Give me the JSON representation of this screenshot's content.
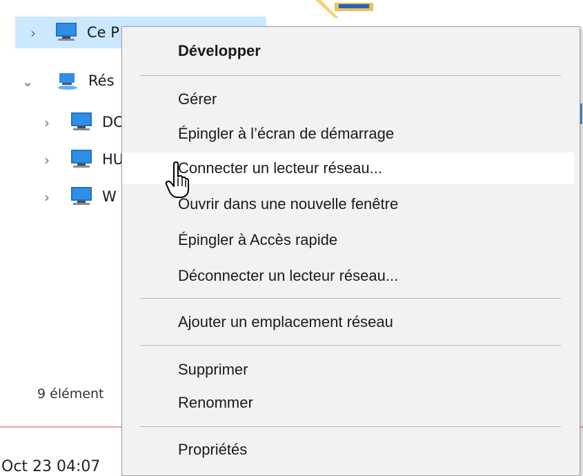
{
  "nav": {
    "items": [
      {
        "label": "Ce P",
        "expanded": false
      },
      {
        "label": "Rés",
        "expanded": true
      },
      {
        "label": "DC",
        "expanded": false
      },
      {
        "label": "HU",
        "expanded": false
      },
      {
        "label": "W",
        "expanded": false
      }
    ],
    "status": "9 élément"
  },
  "taskbar": {
    "time_text": "Oct 23 04:07"
  },
  "context_menu": {
    "items": [
      {
        "label": "Développer",
        "bold": true
      },
      {
        "label": "Gérer"
      },
      {
        "label": "Épingler à l’écran de démarrage"
      },
      {
        "label": "Connecter un lecteur réseau..."
      },
      {
        "label": "Ouvrir dans une nouvelle fenêtre"
      },
      {
        "label": "Épingler à Accès rapide"
      },
      {
        "label": "Déconnecter un lecteur réseau..."
      },
      {
        "label": "Ajouter un emplacement réseau"
      },
      {
        "label": "Supprimer"
      },
      {
        "label": "Renommer"
      },
      {
        "label": "Propriétés"
      }
    ],
    "hovered_index": 3
  },
  "colors": {
    "selection": "#cce8ff",
    "menu_bg": "#f2f2f2",
    "hover_bg": "#ffffff",
    "separator": "#b5b5b5"
  },
  "icons": [
    "chevron-right-icon",
    "chevron-down-icon",
    "computer-icon",
    "network-icon",
    "folder-icon",
    "hand-cursor-icon"
  ]
}
